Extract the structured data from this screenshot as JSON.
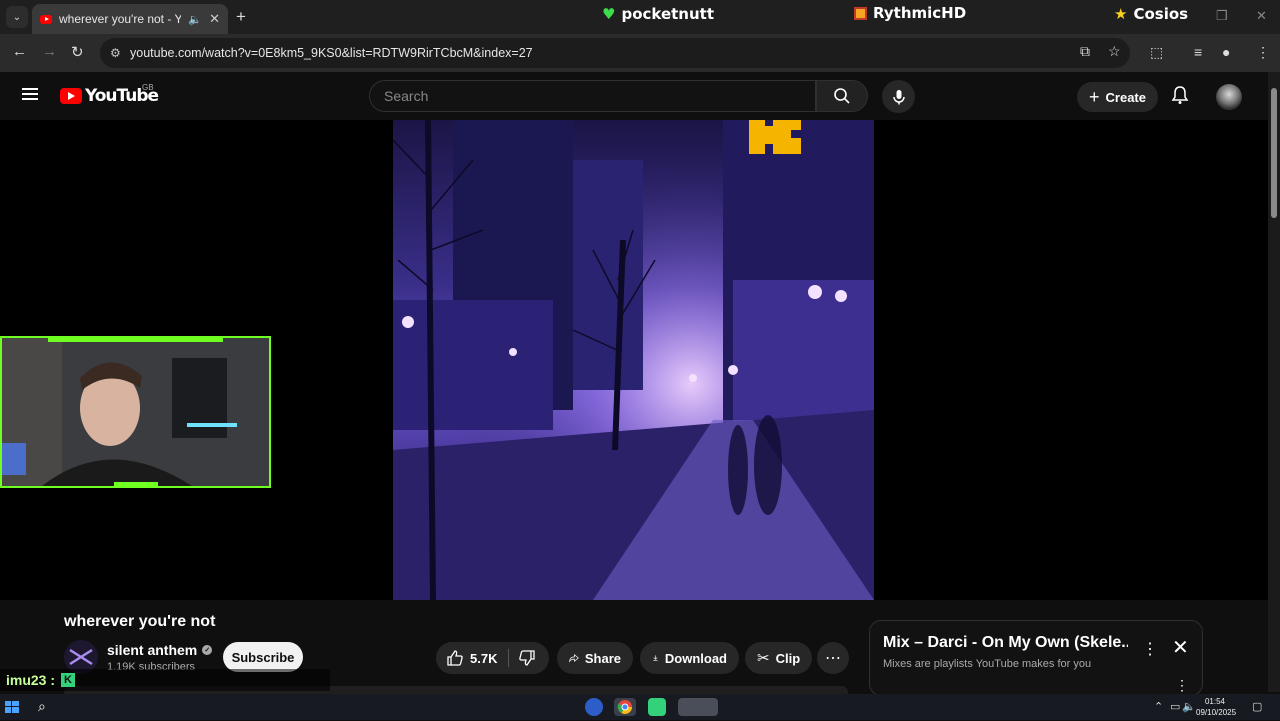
{
  "browser": {
    "tab_title": "wherever you're not - YouTube",
    "url": "youtube.com/watch?v=0E8km5_9KS0&list=RDTW9RirTCbcM&index=27",
    "overlay_labels": [
      {
        "text": "pocketnutt",
        "icon": "green-heart-icon"
      },
      {
        "text": "RythmicHD",
        "icon": "gift-icon"
      },
      {
        "text": "Cosios",
        "icon": "star-icon"
      }
    ]
  },
  "youtube": {
    "logo_text": "YouTube",
    "region": "GB",
    "search_placeholder": "Search",
    "create_label": "Create"
  },
  "video": {
    "title": "wherever you're not",
    "channel": "silent anthem",
    "subscribers": "1.19K subscribers",
    "subscribe_label": "Subscribe",
    "likes": "5.7K",
    "share_label": "Share",
    "download_label": "Download",
    "clip_label": "Clip"
  },
  "mix_panel": {
    "title": "Mix – Darci - On My Own (Skele...",
    "subtitle": "Mixes are playlists YouTube makes for you"
  },
  "chat": {
    "user": "imu23 :"
  },
  "taskbar": {
    "time": "01:54",
    "date": "09/10/2025"
  },
  "colors": {
    "youtube_red": "#ff0000",
    "cam_border": "#6fff21",
    "video_purple": "#6b56c9"
  }
}
